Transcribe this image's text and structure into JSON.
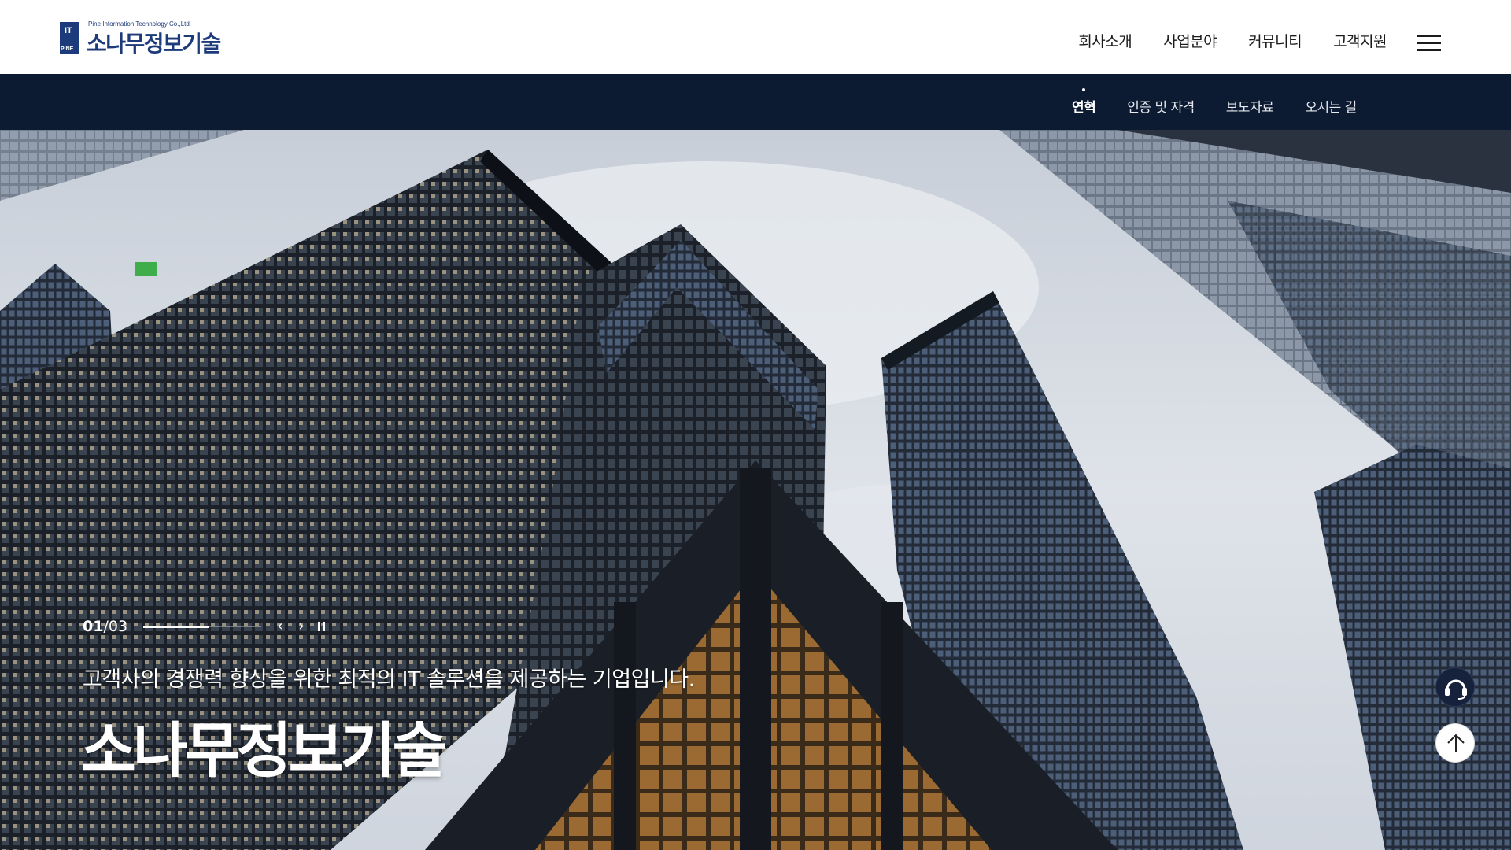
{
  "header": {
    "logo": {
      "mark_text_top": "IT",
      "mark_text_bottom": "PINE",
      "subtitle": "Pine Information Technology Co.,Ltd",
      "name": "소나무정보기술"
    },
    "nav": [
      "회사소개",
      "사업분야",
      "커뮤니티",
      "고객지원"
    ],
    "menu_icon": "hamburger-menu-icon"
  },
  "subnav": {
    "items": [
      {
        "label": "연혁",
        "active": true
      },
      {
        "label": "인증 및 자격",
        "active": false
      },
      {
        "label": "보도자료",
        "active": false
      },
      {
        "label": "오시는 길",
        "active": false
      }
    ]
  },
  "hero": {
    "current_slide": "01",
    "total_slides": "/03",
    "progress": 0.55,
    "prev_icon": "chevron-left-icon",
    "next_icon": "chevron-right-icon",
    "pause_icon": "pause-icon",
    "subtitle": "고객사의 경쟁력 향상을 위한 최적의 IT 솔루션을 제공하는 기업입니다.",
    "title": "소나무정보기술",
    "image_description_icon": "skyscrapers-photo"
  },
  "floating": {
    "support_icon": "headset-icon",
    "top_icon": "arrow-up-icon"
  },
  "colors": {
    "brand": "#1d3a7a",
    "subnav_bg": "#0d1b32",
    "support_btn": "#16213c"
  }
}
